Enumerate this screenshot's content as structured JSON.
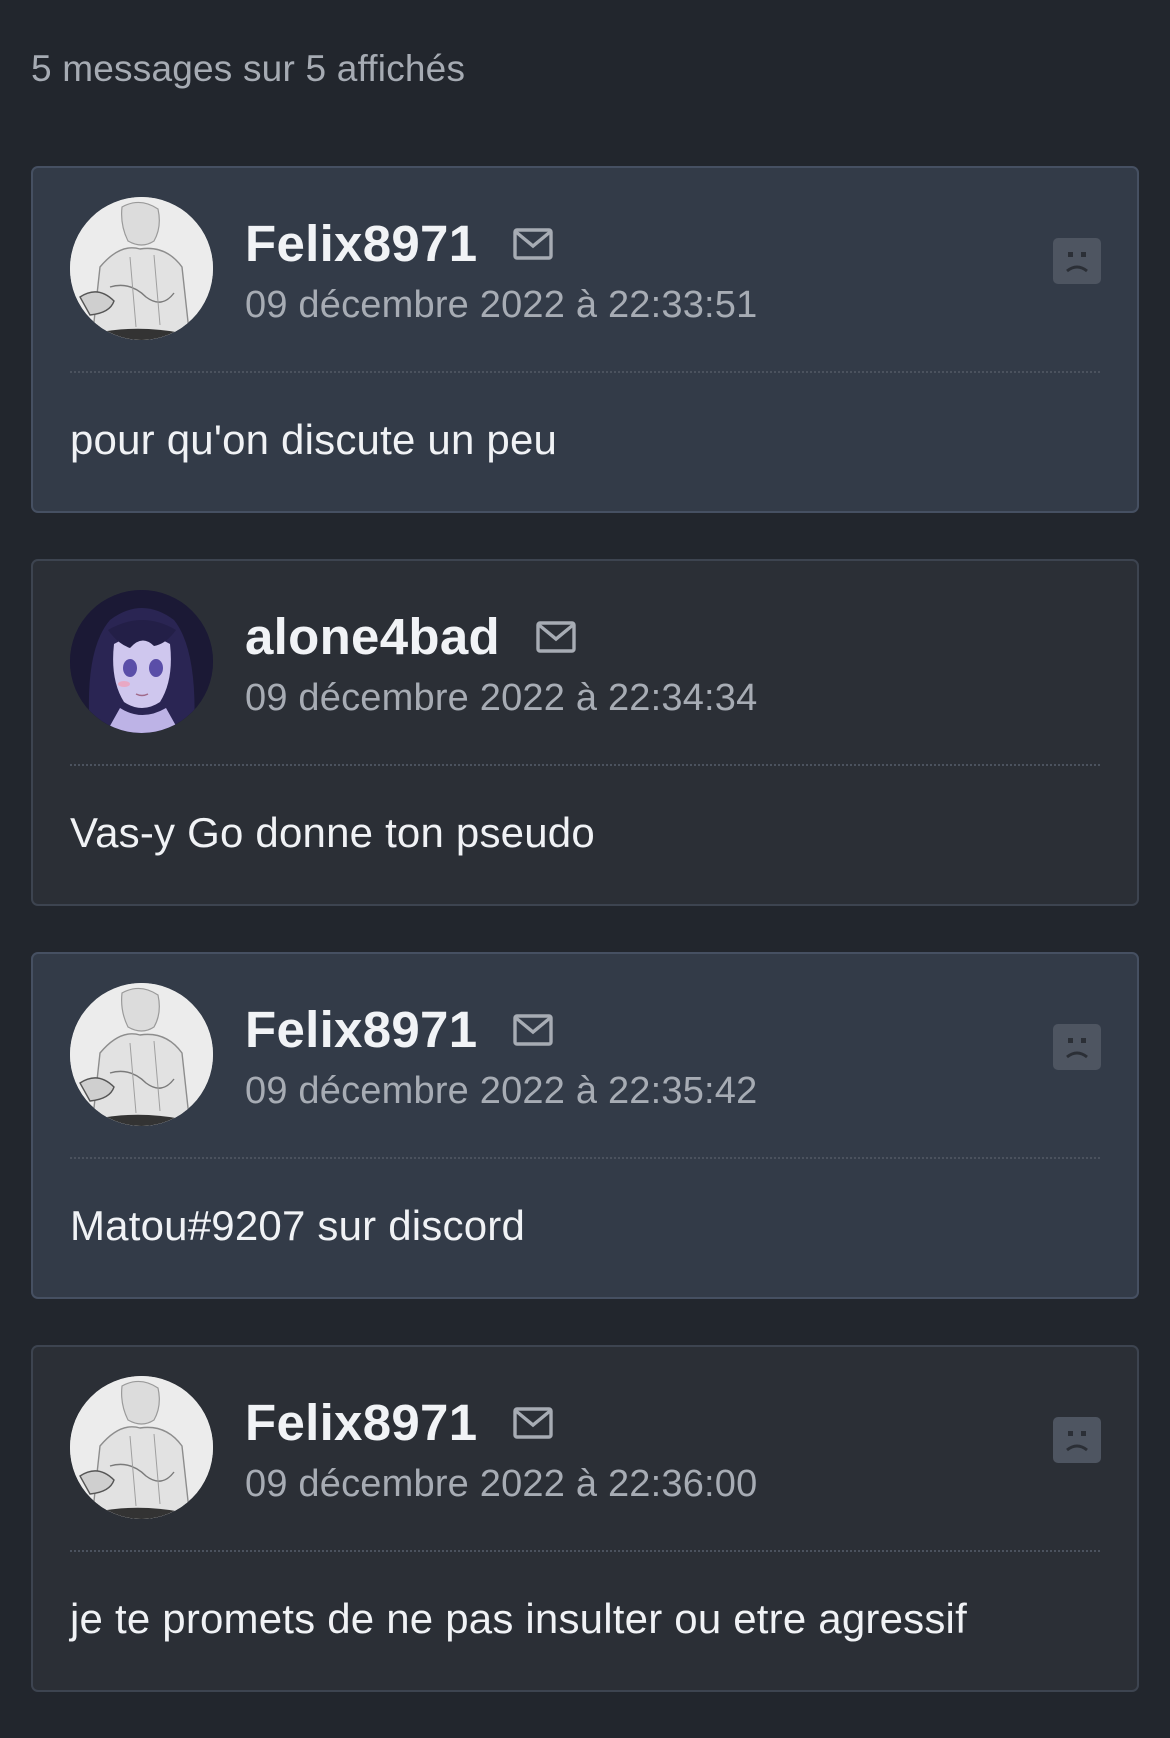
{
  "header": {
    "count_text": "5 messages sur 5 affichés"
  },
  "colors": {
    "background": "#22262d",
    "card": "#2b2f36",
    "card_highlight": "#333b48",
    "muted_text": "#a7acb4"
  },
  "messages": [
    {
      "author": "Felix8971",
      "date": "09 décembre 2022 à 22:33:51",
      "text": "pour qu'on discute un peu",
      "highlight": true,
      "avatar": "sketch-avatar",
      "has_report": true
    },
    {
      "author": "alone4bad",
      "date": "09 décembre 2022 à 22:34:34",
      "text": "Vas-y Go donne ton pseudo",
      "highlight": false,
      "avatar": "anime-avatar",
      "has_report": false
    },
    {
      "author": "Felix8971",
      "date": "09 décembre 2022 à 22:35:42",
      "text": "Matou#9207 sur discord",
      "highlight": true,
      "avatar": "sketch-avatar",
      "has_report": true
    },
    {
      "author": "Felix8971",
      "date": "09 décembre 2022 à 22:36:00",
      "text": "je te promets de ne pas insulter ou etre agressif",
      "highlight": false,
      "avatar": "sketch-avatar",
      "has_report": true
    }
  ]
}
